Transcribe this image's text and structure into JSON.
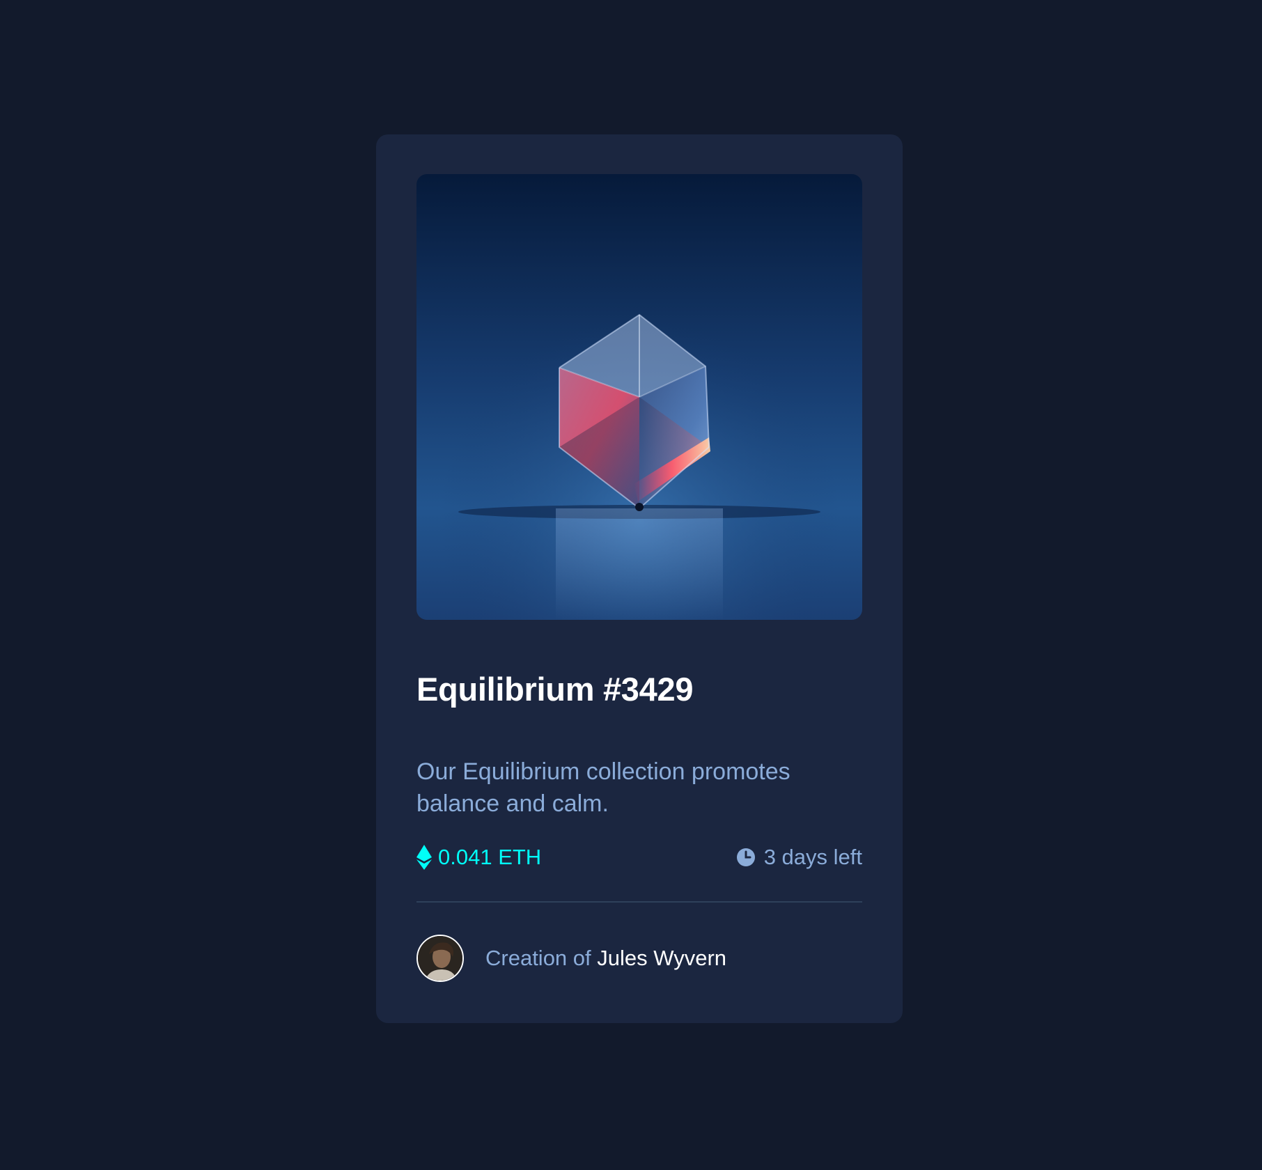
{
  "card": {
    "title": "Equilibrium #3429",
    "description": "Our Equilibrium collection promotes balance and calm.",
    "price": "0.041 ETH",
    "time_left": "3 days left",
    "creator_prefix": "Creation of",
    "creator_name": "Jules Wyvern"
  },
  "icons": {
    "price": "ethereum-icon",
    "time": "clock-icon"
  },
  "colors": {
    "page_background": "#121a2c",
    "card_background": "#1b2640",
    "accent_cyan": "#00fff8",
    "soft_blue": "#8bacd9",
    "white": "#ffffff",
    "divider": "#2e405a"
  }
}
